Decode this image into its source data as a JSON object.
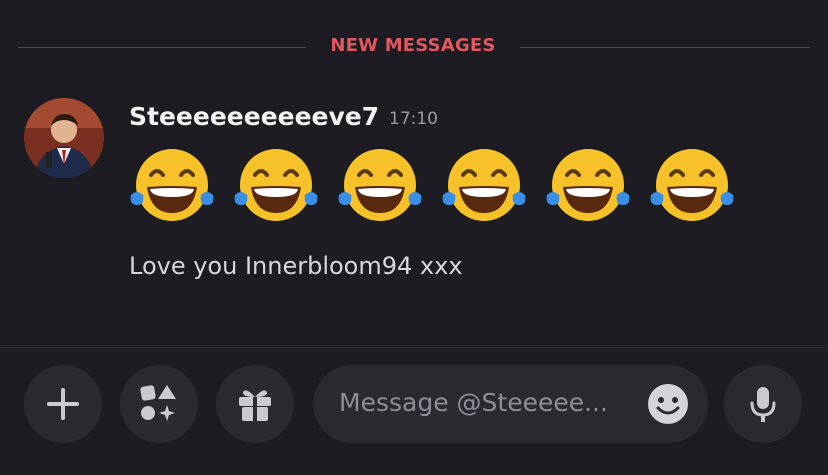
{
  "divider": {
    "label": "NEW MESSAGES"
  },
  "message": {
    "author": "Steeeeeeeeeeve7",
    "timestamp": "17:10",
    "emojis": [
      "laughing-tears",
      "laughing-tears",
      "laughing-tears",
      "laughing-tears",
      "laughing-tears",
      "laughing-tears"
    ],
    "text": "Love you Innerbloom94 xxx"
  },
  "composer": {
    "placeholder": "Message @Steeeee...",
    "buttons": [
      "plus-icon",
      "apps-icon",
      "gift-icon",
      "mic-icon"
    ]
  },
  "colors": {
    "background": "#1c1c22",
    "new_messages_red": "#e0585f",
    "button_bg": "#2a2b31"
  }
}
